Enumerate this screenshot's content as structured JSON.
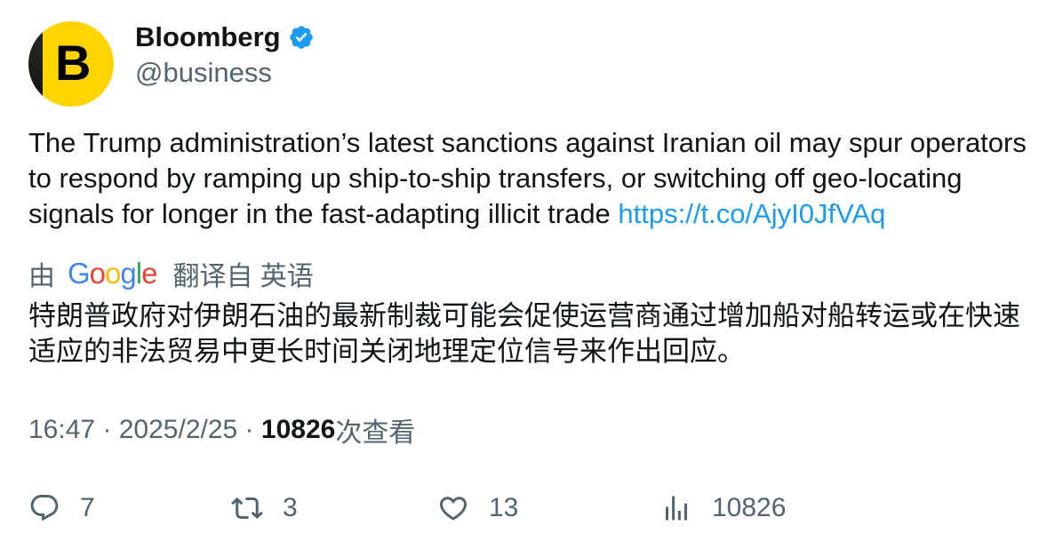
{
  "account": {
    "name": "Bloomberg",
    "handle": "@business",
    "avatar_letter": "B"
  },
  "tweet": {
    "text": "The Trump administration’s latest sanctions against Iranian oil may spur operators to respond by ramping up ship-to-ship transfers, or switching off geo-locating signals for longer in the fast-adapting illicit trade ",
    "link": "https://t.co/AjyI0JfVAq"
  },
  "translation": {
    "prefix": "由",
    "provider": "Google",
    "suffix": "翻译自 英语",
    "text": "特朗普政府对伊朗石油的最新制裁可能会促使运营商通过增加船对船转运或在快速适应的非法贸易中更长时间关闭地理定位信号来作出回应。"
  },
  "meta": {
    "time": "16:47",
    "separator": " · ",
    "date": "2025/2/25",
    "views": "10826",
    "views_label": "次查看"
  },
  "actions": {
    "replies": "7",
    "retweets": "3",
    "likes": "13",
    "views": "10826"
  },
  "colors": {
    "text": "#0f1419",
    "secondary": "#536471",
    "link": "#1d9bf0",
    "verified": "#1d9bf0",
    "avatar_bg": "#ffd400"
  },
  "icons": {
    "verified": "verified-badge-icon",
    "reply": "reply-icon",
    "retweet": "retweet-icon",
    "like": "heart-icon",
    "views": "bar-chart-icon"
  }
}
